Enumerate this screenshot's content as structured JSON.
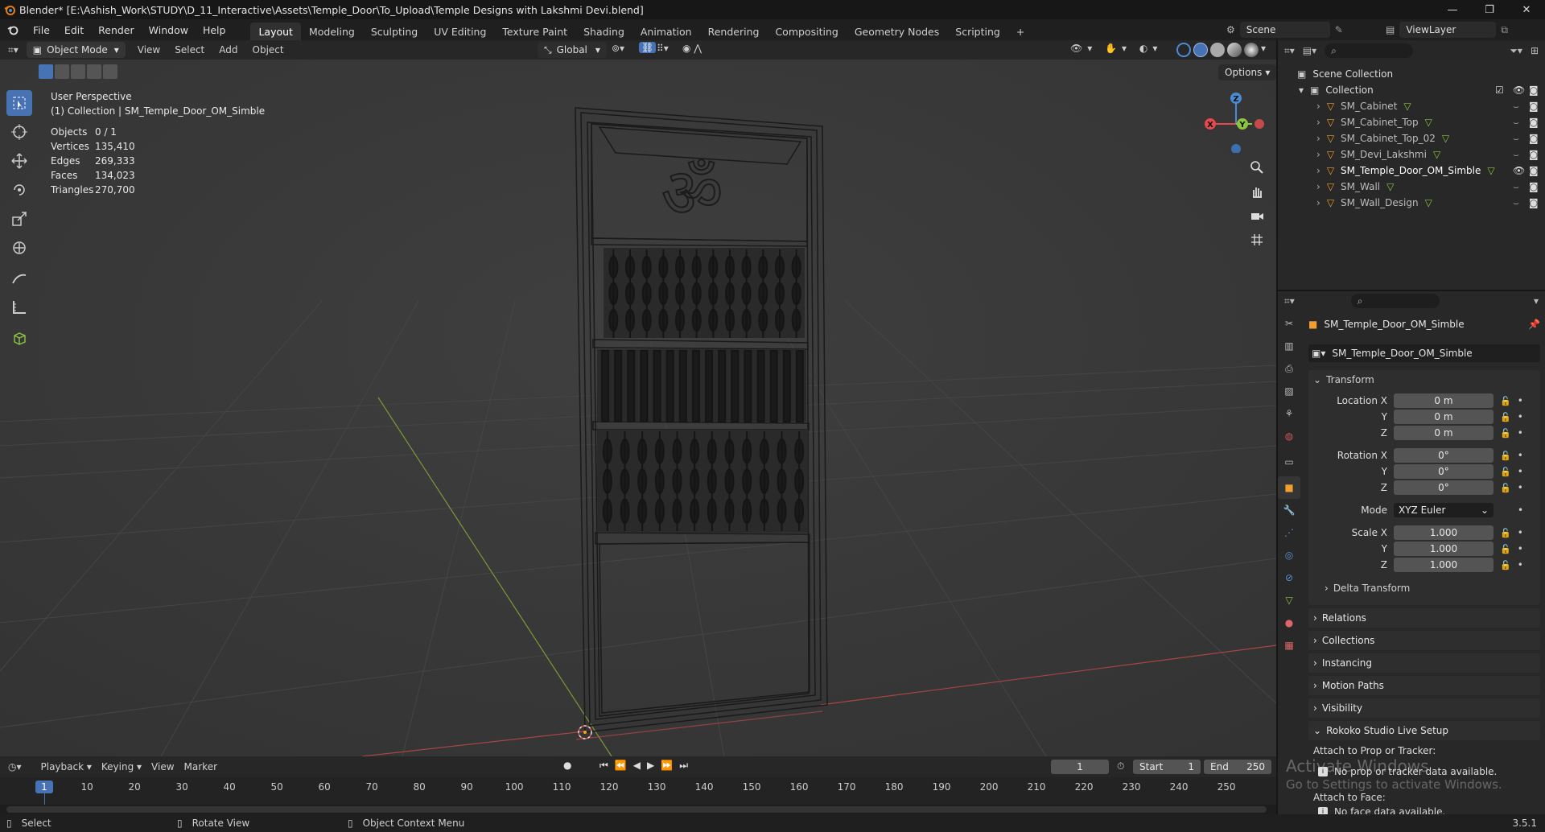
{
  "window": {
    "title": "Blender* [E:\\Ashish_Work\\STUDY\\D_11_Interactive\\Assets\\Temple_Door\\To_Upload\\Temple Designs with Lakshmi Devi.blend]",
    "controls": [
      "—",
      "❐",
      "✕"
    ]
  },
  "menu": [
    "File",
    "Edit",
    "Render",
    "Window",
    "Help"
  ],
  "workspaces": [
    "Layout",
    "Modeling",
    "Sculpting",
    "UV Editing",
    "Texture Paint",
    "Shading",
    "Animation",
    "Rendering",
    "Compositing",
    "Geometry Nodes",
    "Scripting"
  ],
  "workspace_add": "+",
  "active_workspace": "Layout",
  "scene": {
    "name": "Scene",
    "view_layer": "ViewLayer"
  },
  "viewport_header": {
    "mode": "Object Mode",
    "menus": [
      "View",
      "Select",
      "Add",
      "Object"
    ],
    "transform_orientation": "Global",
    "options_label": "Options"
  },
  "viewport": {
    "perspective": "User Perspective",
    "collection_line": "(1) Collection | SM_Temple_Door_OM_Simble",
    "stats": [
      {
        "label": "Objects",
        "value": "0 / 1"
      },
      {
        "label": "Vertices",
        "value": "135,410"
      },
      {
        "label": "Edges",
        "value": "269,333"
      },
      {
        "label": "Faces",
        "value": "134,023"
      },
      {
        "label": "Triangles",
        "value": "270,700"
      }
    ],
    "gizmo_axes": [
      "Z",
      "X",
      "Y"
    ],
    "om_symbol": "ॐ"
  },
  "outliner": {
    "root": "Scene Collection",
    "collection": "Collection",
    "items": [
      {
        "name": "SM_Cabinet",
        "selected": false
      },
      {
        "name": "SM_Cabinet_Top",
        "selected": false
      },
      {
        "name": "SM_Cabinet_Top_02",
        "selected": false
      },
      {
        "name": "SM_Devi_Lakshmi",
        "selected": false
      },
      {
        "name": "SM_Temple_Door_OM_Simble",
        "selected": true
      },
      {
        "name": "SM_Wall",
        "selected": false
      },
      {
        "name": "SM_Wall_Design",
        "selected": false
      }
    ]
  },
  "properties": {
    "object_name": "SM_Temple_Door_OM_Simble",
    "datablock": "SM_Temple_Door_OM_Simble",
    "transform_label": "Transform",
    "location": {
      "label": "Location X",
      "x": "0 m",
      "y": "0 m",
      "z": "0 m"
    },
    "rotation": {
      "label": "Rotation X",
      "x": "0°",
      "y": "0°",
      "z": "0°"
    },
    "mode_label": "Mode",
    "mode_value": "XYZ Euler",
    "scale": {
      "label": "Scale X",
      "x": "1.000",
      "y": "1.000",
      "z": "1.000"
    },
    "axis_y": "Y",
    "axis_z": "Z",
    "delta": "Delta Transform",
    "sections": [
      "Relations",
      "Collections",
      "Instancing",
      "Motion Paths",
      "Visibility"
    ],
    "rokoko": "Rokoko Studio Live Setup",
    "attach_prop": "Attach to Prop or Tracker:",
    "no_prop": "No prop or tracker data available.",
    "attach_face": "Attach to Face:",
    "no_face": "No face data available."
  },
  "timeline": {
    "menus": [
      "Playback",
      "Keying",
      "View",
      "Marker"
    ],
    "current_frame": "1",
    "start_label": "Start",
    "start": "1",
    "end_label": "End",
    "end": "250",
    "ticks": [
      "1",
      "10",
      "20",
      "30",
      "40",
      "50",
      "60",
      "70",
      "80",
      "90",
      "100",
      "110",
      "120",
      "130",
      "140",
      "150",
      "160",
      "170",
      "180",
      "190",
      "200",
      "210",
      "220",
      "230",
      "240",
      "250"
    ]
  },
  "statusbar": {
    "items": [
      "Select",
      "Rotate View",
      "Object Context Menu"
    ],
    "version": "3.5.1"
  },
  "watermark": {
    "line1": "Activate Windows",
    "line2": "Go to Settings to activate Windows."
  },
  "colors": {
    "accent": "#4772b3",
    "x_axis": "#e5484d",
    "y_axis": "#8cc63e",
    "z_axis": "#4a8bd6",
    "selection": "#f5a623"
  }
}
